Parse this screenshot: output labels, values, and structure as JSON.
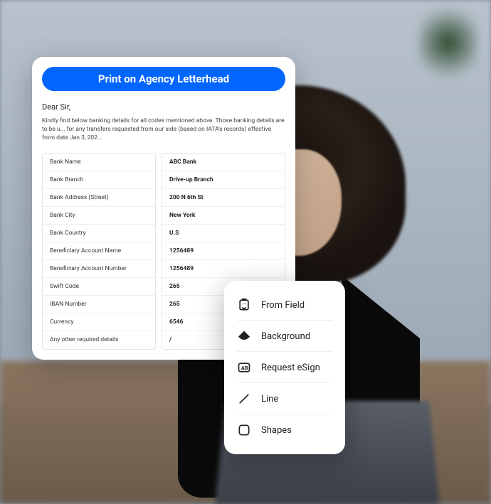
{
  "document": {
    "banner": "Print on Agency Letterhead",
    "salutation": "Dear Sir,",
    "intro": "Kindly find below banking details for all codes mentioned above. Those banking details are to be u... for any transfers requested from our side (based on IATA's records) effective from date Jan 3, 202...",
    "rows": [
      {
        "label": "Bank Name",
        "value": "ABC Bank"
      },
      {
        "label": "Bank Branch",
        "value": "Drive-up Branch"
      },
      {
        "label": "Bank Address (Street)",
        "value": "200 N 6th St"
      },
      {
        "label": "Bank City",
        "value": "New York"
      },
      {
        "label": "Bank Country",
        "value": "U.S"
      },
      {
        "label": "Beneficiary Account Name",
        "value": "1256489"
      },
      {
        "label": "Beneficiary Account Number",
        "value": "1256489"
      },
      {
        "label": "Swift Code",
        "value": "265"
      },
      {
        "label": "IBAN Number",
        "value": "265"
      },
      {
        "label": "Currency",
        "value": "6546"
      },
      {
        "label": "Any other required details",
        "value": "/"
      }
    ]
  },
  "menu": {
    "items": [
      {
        "label": "From Field",
        "icon": "from-field-icon"
      },
      {
        "label": "Background",
        "icon": "background-icon"
      },
      {
        "label": "Request eSign",
        "icon": "esign-icon"
      },
      {
        "label": "Line",
        "icon": "line-icon"
      },
      {
        "label": "Shapes",
        "icon": "shapes-icon"
      }
    ]
  },
  "colors": {
    "accent": "#0066ff"
  }
}
